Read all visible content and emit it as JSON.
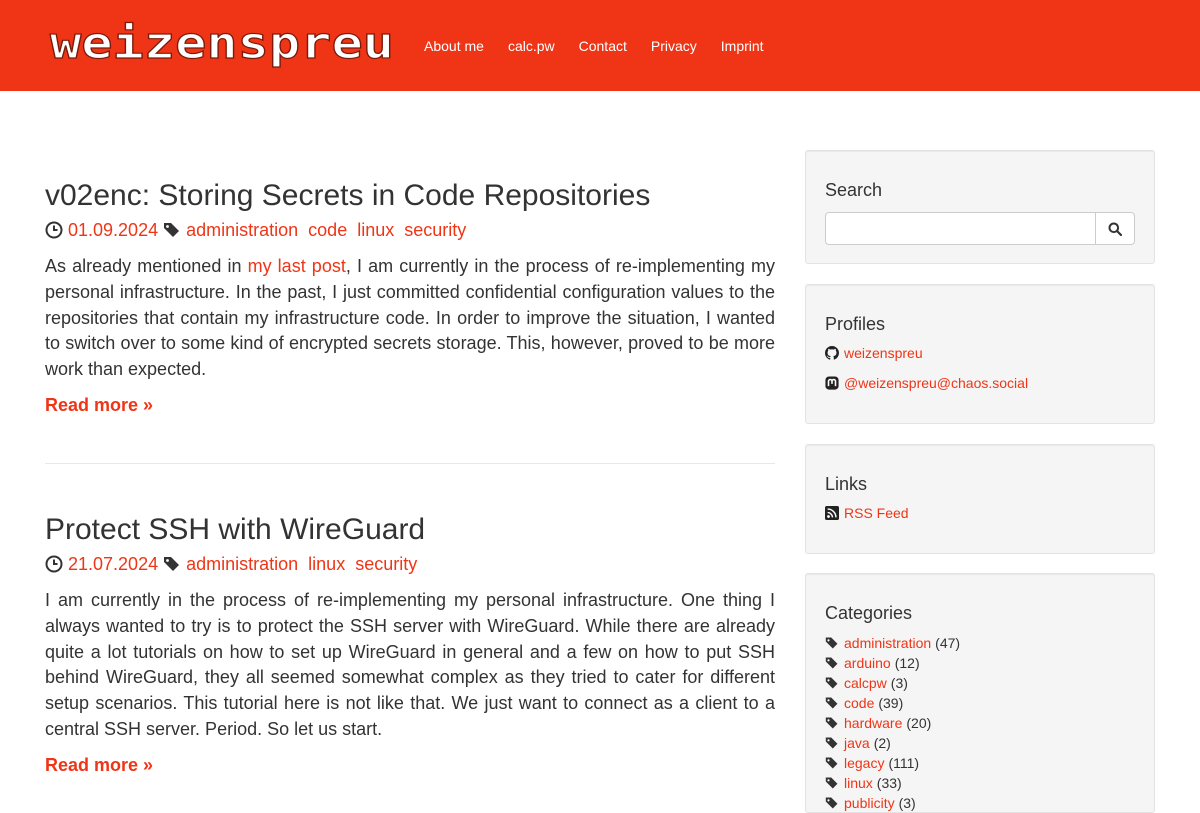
{
  "nav": {
    "brand": "weizenspreu",
    "links": [
      "About me",
      "calc.pw",
      "Contact",
      "Privacy",
      "Imprint"
    ]
  },
  "posts": [
    {
      "title": "v02enc: Storing Secrets in Code Repositories",
      "date": "01.09.2024",
      "tags": [
        "administration",
        "code",
        "linux",
        "security"
      ],
      "excerpt_before": "As already mentioned in ",
      "excerpt_link": "my last post",
      "excerpt_after": ", I am currently in the process of re-implementing my personal infrastructure. In the past, I just committed confidential configuration values to the repositories that contain my infrastructure code. In order to improve the situation, I wanted to switch over to some kind of encrypted secrets storage. This, however, proved to be more work than expected.",
      "read_more": "Read more »"
    },
    {
      "title": "Protect SSH with WireGuard",
      "date": "21.07.2024",
      "tags": [
        "administration",
        "linux",
        "security"
      ],
      "excerpt": "I am currently in the process of re-implementing my personal infrastructure. One thing I always wanted to try is to protect the SSH server with WireGuard. While there are already quite a lot tutorials on how to set up WireGuard in general and a few on how to put SSH behind WireGuard, they all seemed somewhat complex as they tried to cater for different setup scenarios. This tutorial here is not like that. We just want to connect as a client to a central SSH server. Period. So let us start.",
      "read_more": "Read more »"
    }
  ],
  "sidebar": {
    "search": {
      "title": "Search",
      "value": "",
      "icon": "search-icon"
    },
    "profiles": {
      "title": "Profiles",
      "items": [
        {
          "label": "weizenspreu",
          "icon": "github-icon"
        },
        {
          "label": "@weizenspreu@chaos.social",
          "icon": "mastodon-icon"
        }
      ]
    },
    "links": {
      "title": "Links",
      "items": [
        {
          "label": "RSS Feed",
          "icon": "rss-icon"
        }
      ]
    },
    "categories": {
      "title": "Categories",
      "items": [
        {
          "label": "administration",
          "count": "(47)"
        },
        {
          "label": "arduino",
          "count": "(12)"
        },
        {
          "label": "calcpw",
          "count": "(3)"
        },
        {
          "label": "code",
          "count": "(39)"
        },
        {
          "label": "hardware",
          "count": "(20)"
        },
        {
          "label": "java",
          "count": "(2)"
        },
        {
          "label": "legacy",
          "count": "(111)"
        },
        {
          "label": "linux",
          "count": "(33)"
        },
        {
          "label": "publicity",
          "count": "(3)"
        }
      ]
    }
  },
  "colors": {
    "accent": "#ef3516",
    "text": "#333333",
    "widget_bg": "#f5f5f5"
  }
}
